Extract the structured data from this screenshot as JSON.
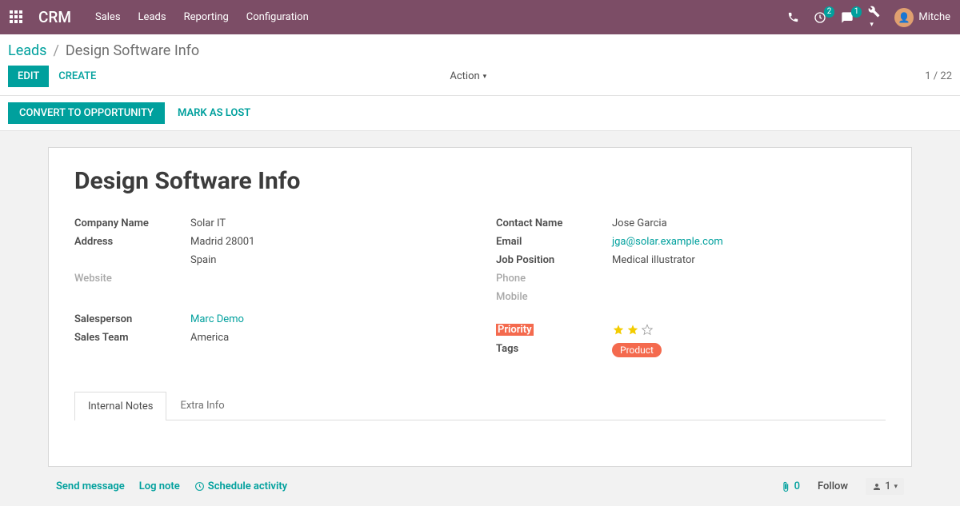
{
  "topbar": {
    "brand": "CRM",
    "nav": [
      "Sales",
      "Leads",
      "Reporting",
      "Configuration"
    ],
    "activities_badge": "2",
    "discuss_badge": "1",
    "user_name": "Mitche"
  },
  "breadcrumbs": {
    "root": "Leads",
    "current": "Design Software Info"
  },
  "controls": {
    "edit": "EDIT",
    "create": "CREATE",
    "action": "Action",
    "pager": "1 / 22",
    "convert": "CONVERT TO OPPORTUNITY",
    "mark_lost": "MARK AS LOST"
  },
  "record": {
    "title": "Design Software Info",
    "left_labels": {
      "company": "Company Name",
      "address": "Address",
      "website": "Website",
      "salesperson": "Salesperson",
      "sales_team": "Sales Team"
    },
    "left_values": {
      "company": "Solar IT",
      "addr1": "Madrid  28001",
      "addr2": "Spain",
      "salesperson": "Marc Demo",
      "sales_team": "America"
    },
    "right_labels": {
      "contact": "Contact Name",
      "email": "Email",
      "job": "Job Position",
      "phone": "Phone",
      "mobile": "Mobile",
      "priority": "Priority",
      "tags": "Tags"
    },
    "right_values": {
      "contact": "Jose Garcia",
      "email": "jga@solar.example.com",
      "job": "Medical illustrator",
      "tag": "Product"
    },
    "priority_stars": 2,
    "priority_max": 3
  },
  "tabs": {
    "internal": "Internal Notes",
    "extra": "Extra Info"
  },
  "chatter": {
    "send": "Send message",
    "log": "Log note",
    "schedule": "Schedule activity",
    "attachments": "0",
    "follow": "Follow",
    "followers": "1"
  }
}
